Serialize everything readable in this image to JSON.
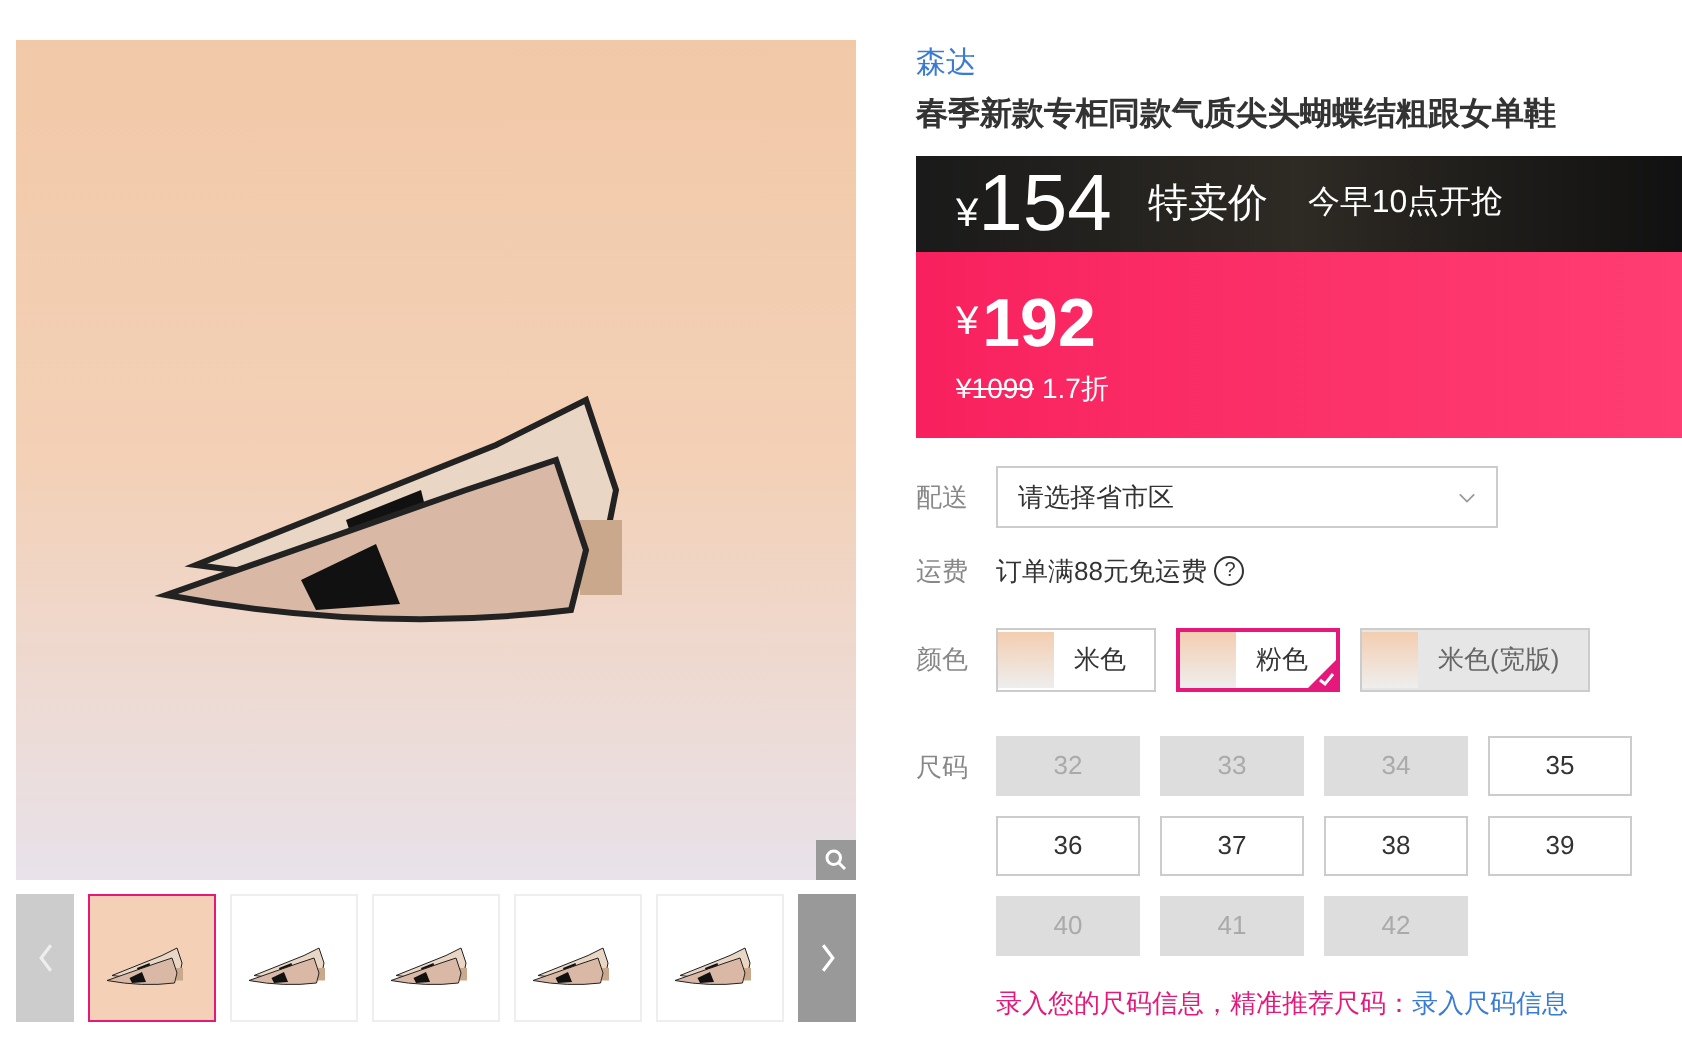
{
  "gallery": {
    "thumbnails": [
      {
        "selected": true
      },
      {
        "selected": false
      },
      {
        "selected": false
      },
      {
        "selected": false
      },
      {
        "selected": false
      }
    ]
  },
  "product": {
    "brand": "森达",
    "title": "春季新款专柜同款气质尖头蝴蝶结粗跟女单鞋"
  },
  "promo": {
    "currency": "¥",
    "price": "154",
    "label": "特卖价",
    "start": "今早10点开抢"
  },
  "price": {
    "currency": "¥",
    "price": "192",
    "original": "¥1099",
    "discount": "1.7折"
  },
  "delivery": {
    "label": "配送",
    "placeholder": "请选择省市区"
  },
  "shipping": {
    "label": "运费",
    "text": "订单满88元免运费",
    "help": "?"
  },
  "colors": {
    "label": "颜色",
    "options": [
      {
        "name": "米色",
        "selected": false,
        "disabled": false
      },
      {
        "name": "粉色",
        "selected": true,
        "disabled": false
      },
      {
        "name": "米色(宽版)",
        "selected": false,
        "disabled": true
      }
    ]
  },
  "sizes": {
    "label": "尺码",
    "options": [
      {
        "size": "32",
        "disabled": true
      },
      {
        "size": "33",
        "disabled": true
      },
      {
        "size": "34",
        "disabled": true
      },
      {
        "size": "35",
        "disabled": false
      },
      {
        "size": "36",
        "disabled": false
      },
      {
        "size": "37",
        "disabled": false
      },
      {
        "size": "38",
        "disabled": false
      },
      {
        "size": "39",
        "disabled": false
      },
      {
        "size": "40",
        "disabled": true
      },
      {
        "size": "41",
        "disabled": true
      },
      {
        "size": "42",
        "disabled": true
      }
    ]
  },
  "size_hint": {
    "text": "录入您的尺码信息，精准推荐尺码：",
    "link": "录入尺码信息"
  }
}
